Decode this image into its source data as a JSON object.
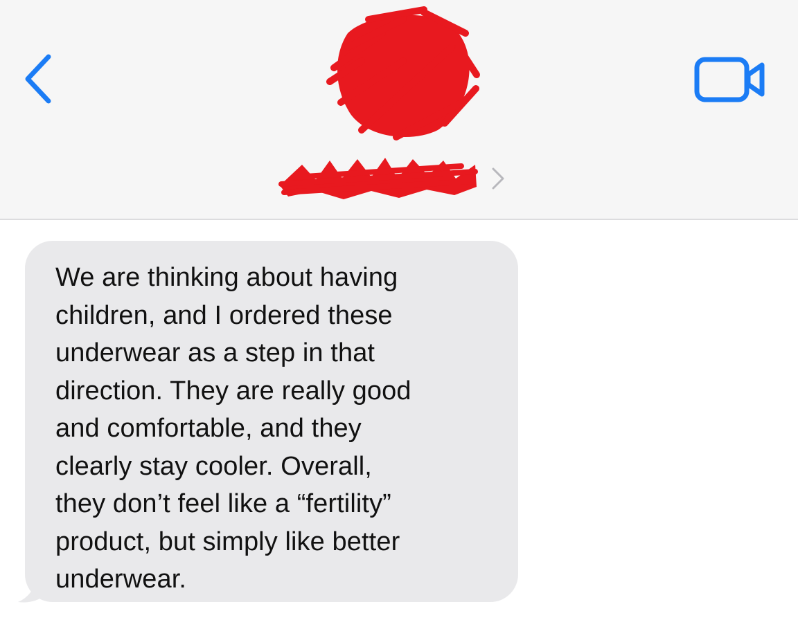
{
  "header": {
    "back_icon": "chevron-left-icon",
    "video_icon": "video-camera-icon",
    "contact_name": "",
    "contact_chevron_icon": "chevron-right-icon",
    "avatar_redaction_color": "#e8191f",
    "accent_color": "#1b7cf5"
  },
  "messages": [
    {
      "direction": "incoming",
      "text": "We are thinking about having\nchildren, and I ordered these\nunderwear as a step in that\ndirection. They are really good\nand comfortable, and they\nclearly stay cooler. Overall,\nthey don’t feel like a “fertility”\nproduct, but simply like better\nunderwear."
    }
  ]
}
